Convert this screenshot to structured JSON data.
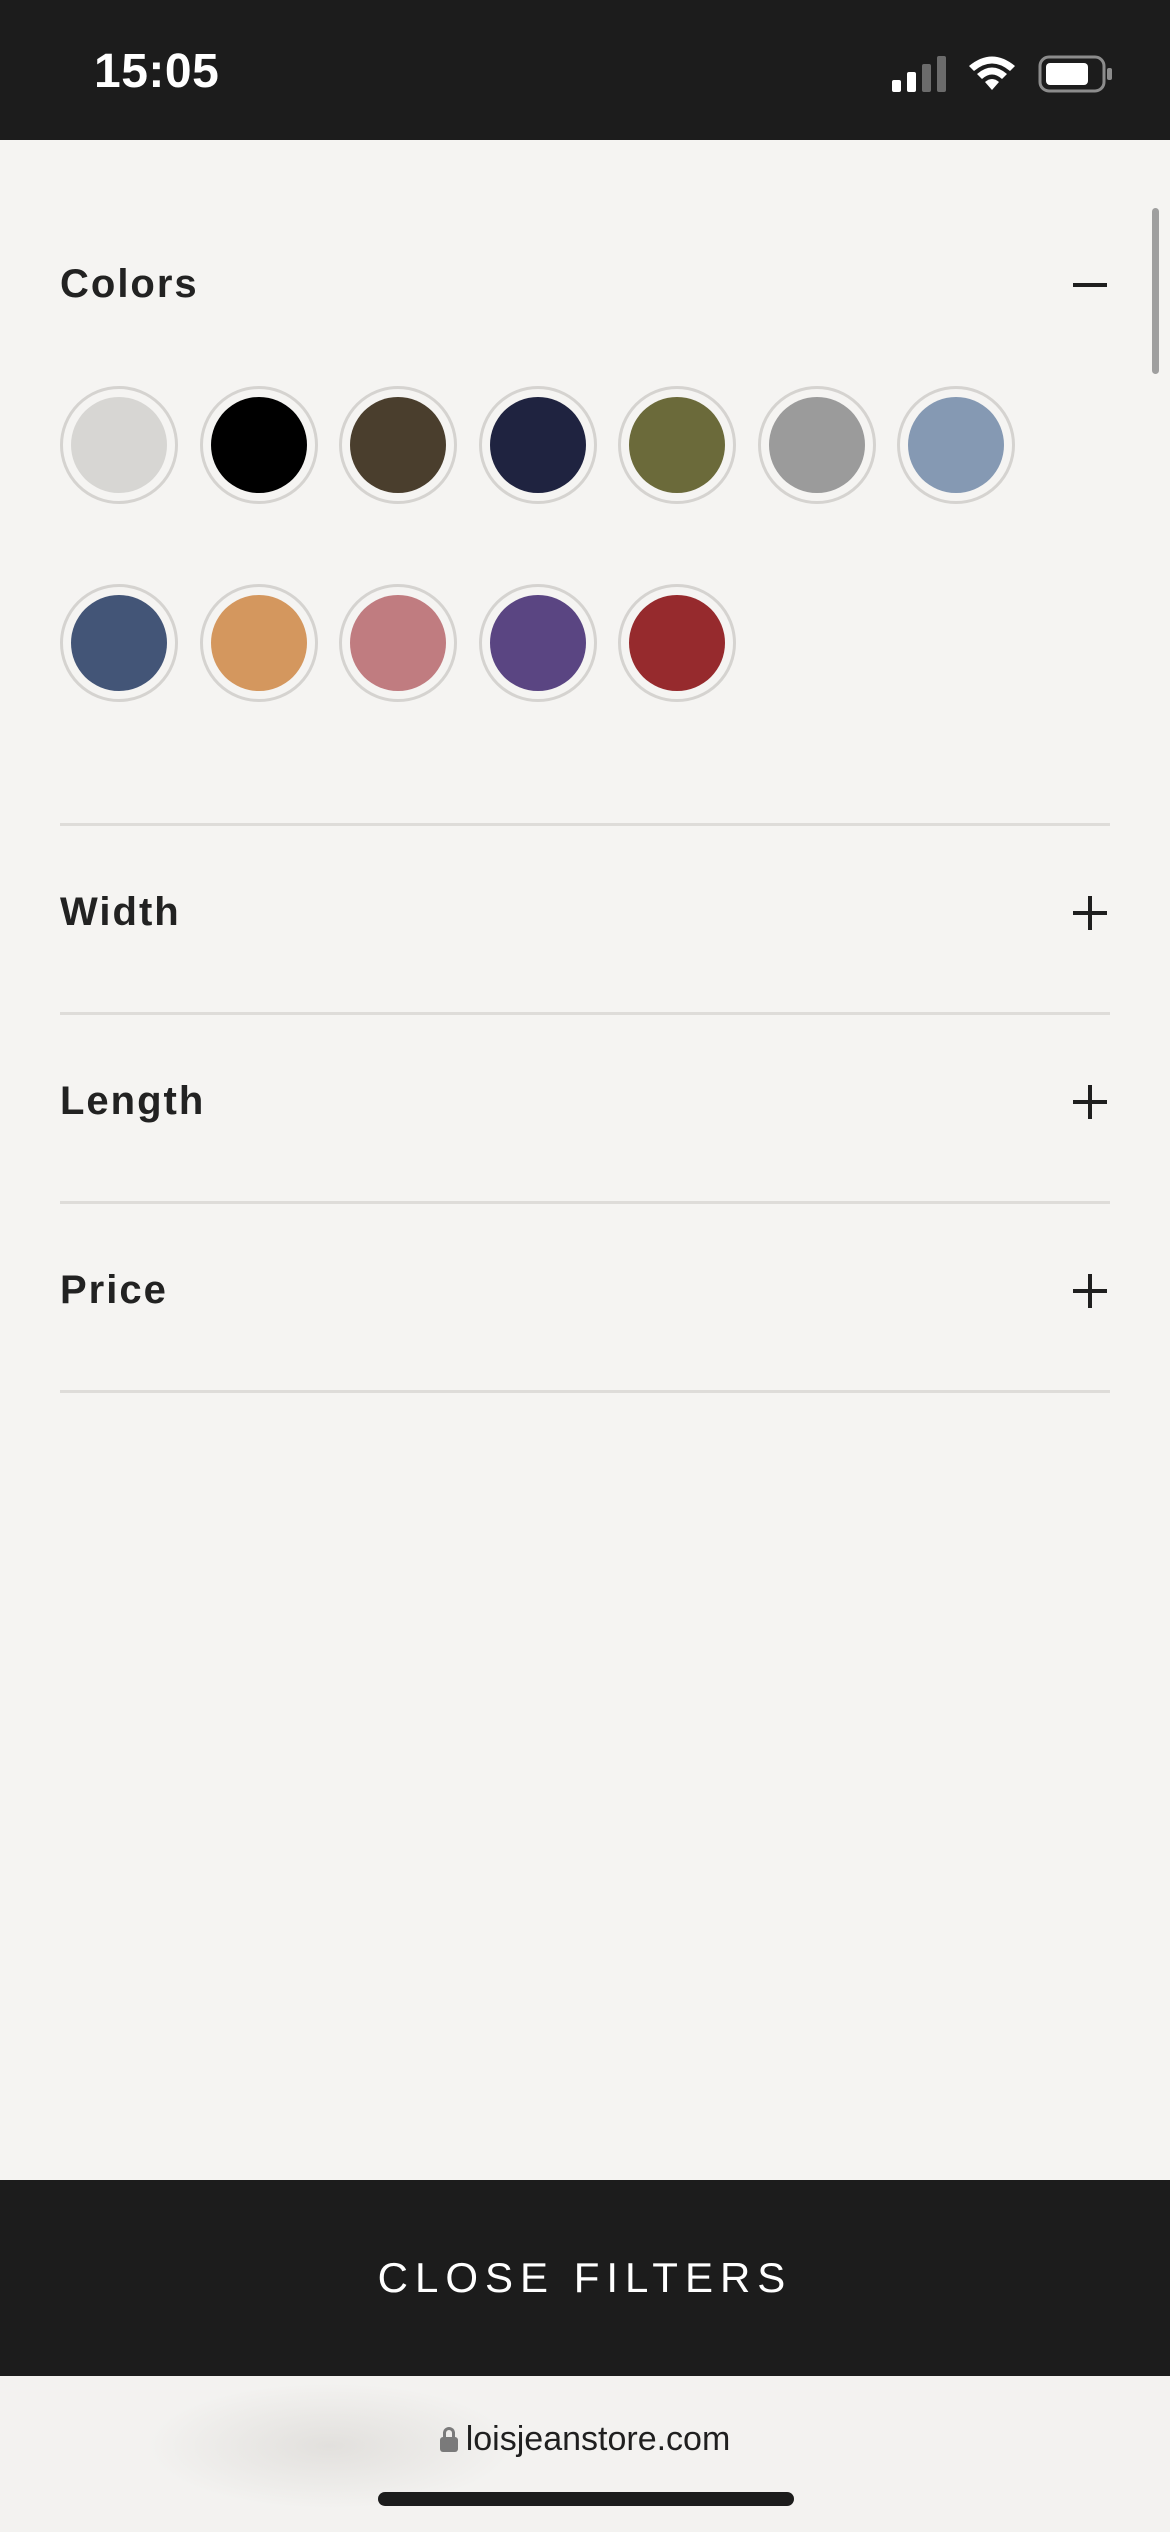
{
  "status_bar": {
    "time": "15:05",
    "icons": [
      "signal-icon",
      "wifi-icon",
      "battery-icon"
    ]
  },
  "filters": {
    "sections": [
      {
        "title": "Colors",
        "expanded": true,
        "toggle_icon": "minus-icon"
      },
      {
        "title": "Width",
        "expanded": false,
        "toggle_icon": "plus-icon"
      },
      {
        "title": "Length",
        "expanded": false,
        "toggle_icon": "plus-icon"
      },
      {
        "title": "Price",
        "expanded": false,
        "toggle_icon": "plus-icon"
      }
    ],
    "colors": [
      "#d7d6d3",
      "#000000",
      "#4a3e2d",
      "#1f2340",
      "#6b6a3a",
      "#9b9b9b",
      "#8599b3",
      "#435577",
      "#d4975e",
      "#c07c80",
      "#5a4582",
      "#962a2d"
    ]
  },
  "close_button": {
    "label": "CLOSE FILTERS"
  },
  "browser": {
    "url": "loisjeanstore.com"
  }
}
